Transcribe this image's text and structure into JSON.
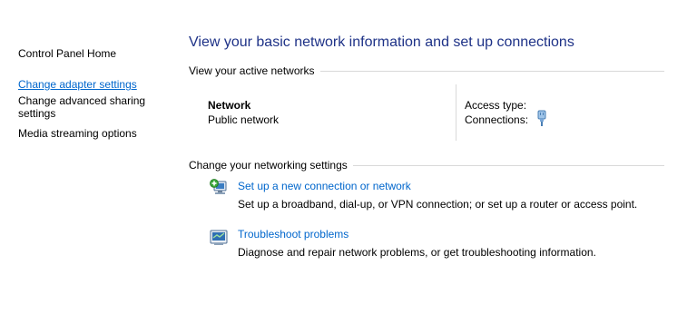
{
  "left_pane": {
    "home": "Control Panel Home",
    "links": [
      "Change adapter settings",
      "Change advanced sharing settings",
      "Media streaming options"
    ]
  },
  "main": {
    "title": "View your basic network information and set up connections",
    "active_section": "View your active networks",
    "network": {
      "name": "Network",
      "type": "Public network",
      "access_label": "Access type:",
      "connections_label": "Connections:"
    },
    "change_section": "Change your networking settings",
    "tasks": [
      {
        "icon": "new-connection-icon",
        "link": "Set up a new connection or network",
        "description": "Set up a broadband, dial-up, or VPN connection; or set up a router or access point."
      },
      {
        "icon": "troubleshoot-icon",
        "link": "Troubleshoot problems",
        "description": "Diagnose and repair network problems, or get troubleshooting information."
      }
    ]
  },
  "colors": {
    "title": "#1e3287",
    "link": "#0066cc",
    "divider": "#d9d9d9"
  }
}
